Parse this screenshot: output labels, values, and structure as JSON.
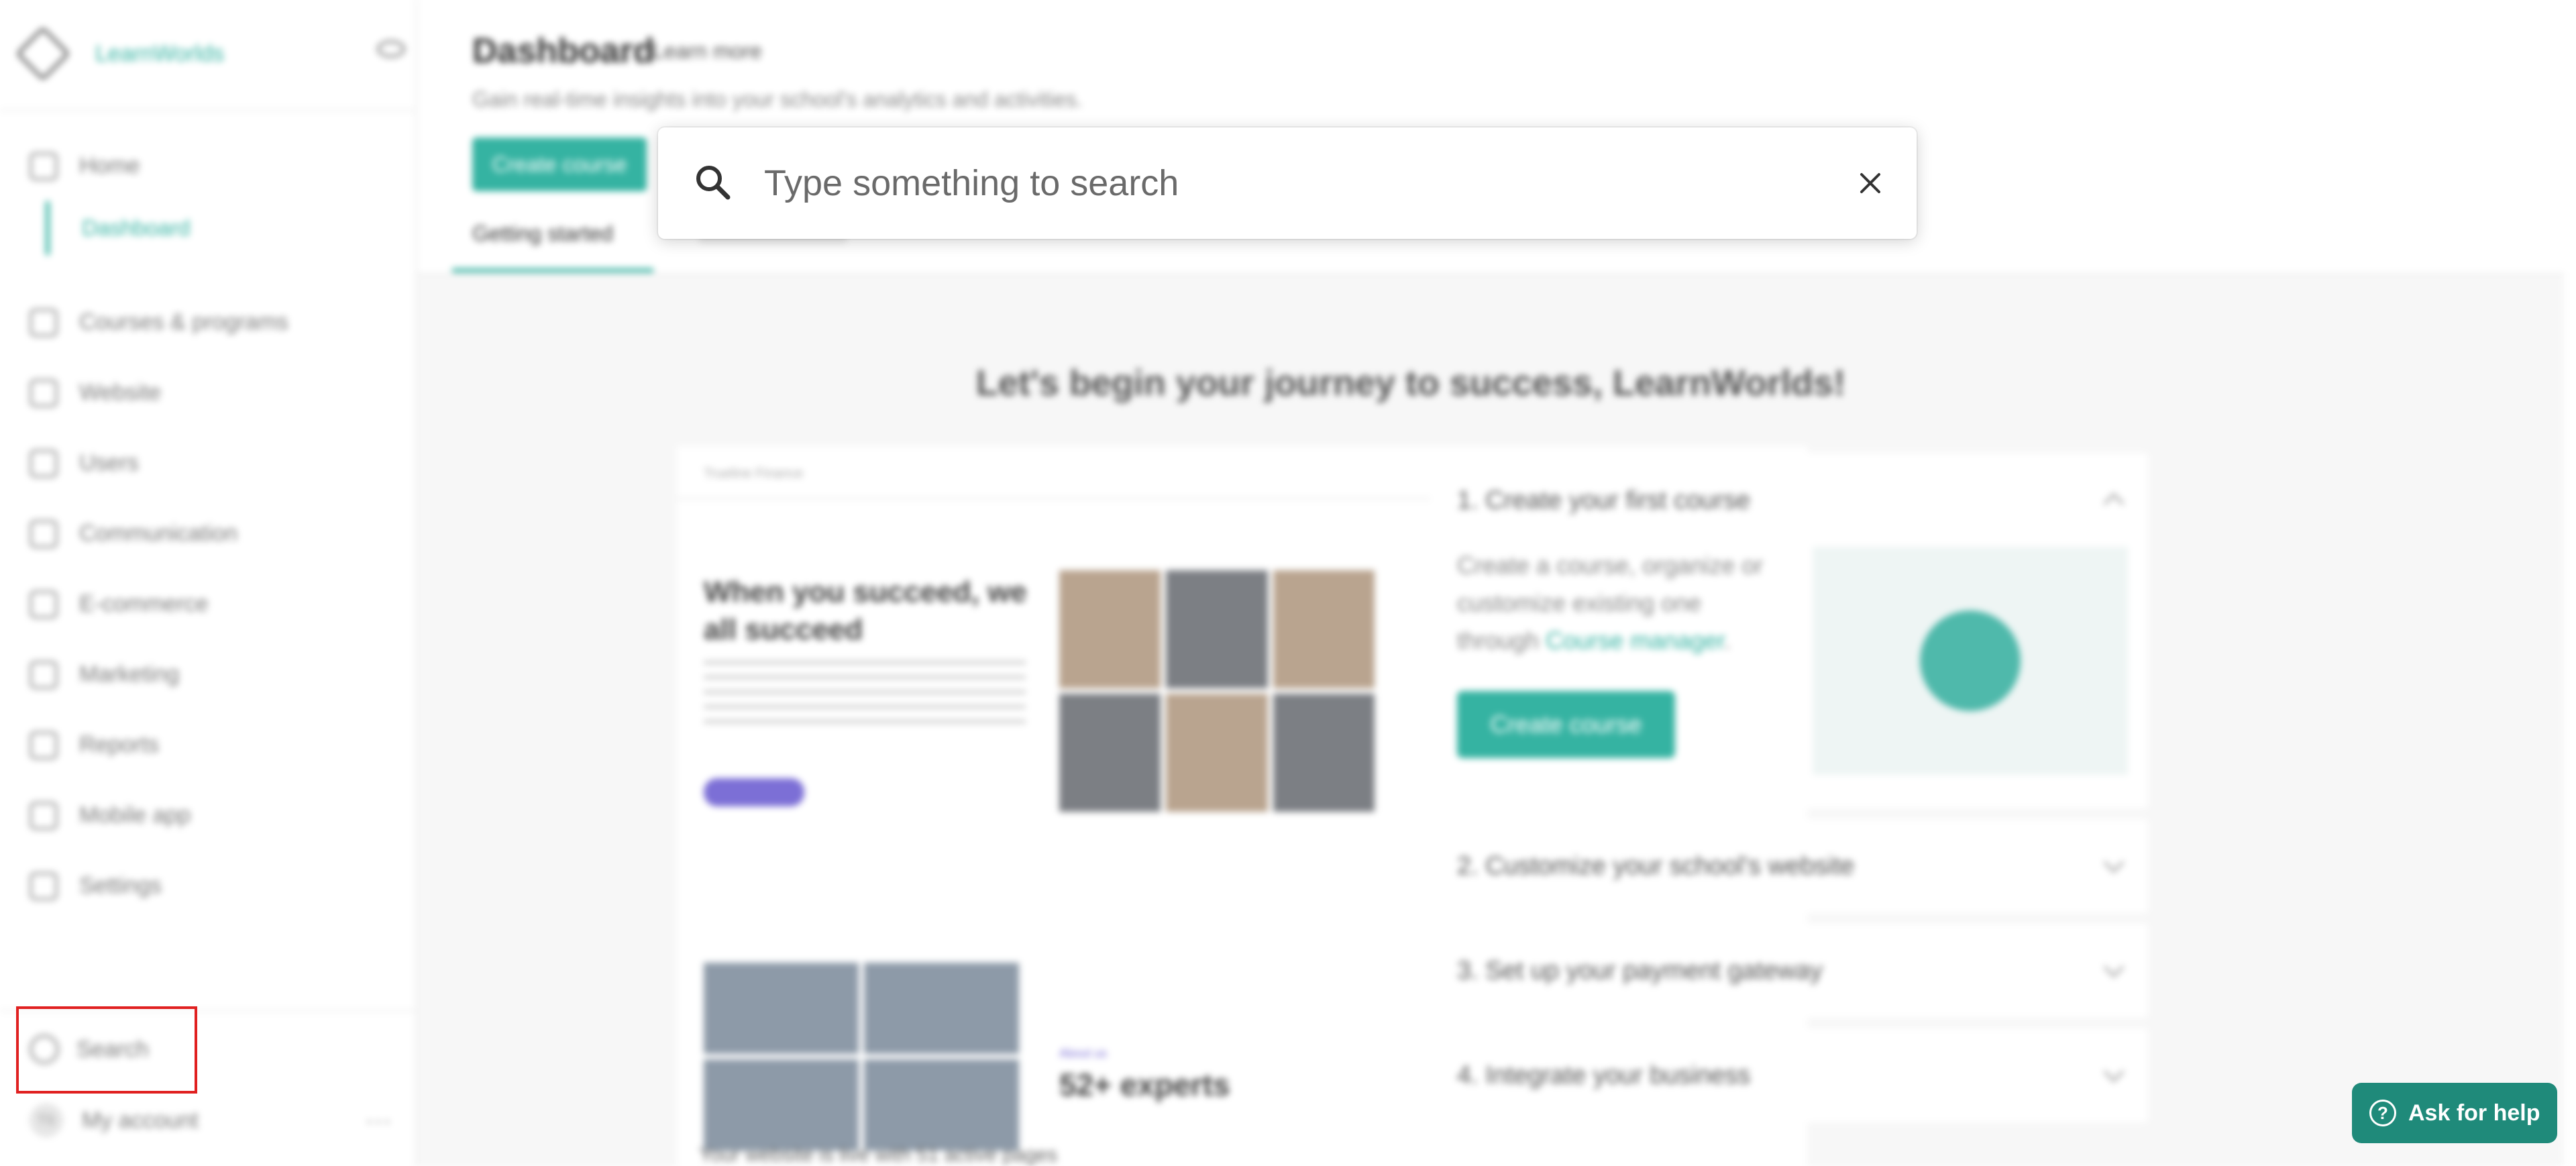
{
  "sidebar": {
    "brand": "LearnWorlds",
    "items": [
      {
        "label": "Home",
        "icon": "home-icon"
      },
      {
        "label": "Courses & programs",
        "icon": "courses-icon"
      },
      {
        "label": "Website",
        "icon": "website-icon"
      },
      {
        "label": "Users",
        "icon": "users-icon"
      },
      {
        "label": "Communication",
        "icon": "mail-icon"
      },
      {
        "label": "E-commerce",
        "icon": "cart-icon"
      },
      {
        "label": "Marketing",
        "icon": "funnel-icon"
      },
      {
        "label": "Reports",
        "icon": "reports-icon"
      },
      {
        "label": "Mobile app",
        "icon": "mobile-icon"
      },
      {
        "label": "Settings",
        "icon": "gear-icon"
      }
    ],
    "subitem": "Dashboard",
    "search_label": "Search",
    "account_initials": "TS",
    "account_label": "My account",
    "more": "···"
  },
  "header": {
    "title": "Dashboard",
    "learn_more": "Learn more",
    "subtitle": "Gain real-time insights into your school's analytics and activities.",
    "create_course": "Create course",
    "tab_active": "Getting started"
  },
  "main": {
    "welcome": "Let's begin your journey to success, LearnWorlds!",
    "preview": {
      "site_name": "Trueline Finance",
      "headline": "When you succeed, we all succeed",
      "experts_label": "About us",
      "experts": "52+ experts",
      "live_text": "Your website is live with 51 active pages"
    },
    "steps": [
      {
        "title": "1. Create your first course",
        "desc_pre": "Create a course, organize or customize existing one through ",
        "desc_link": "Course manager",
        "desc_post": ".",
        "button": "Create course"
      },
      {
        "title": "2. Customize your school's website"
      },
      {
        "title": "3. Set up your payment gateway"
      },
      {
        "title": "4. Integrate your business"
      }
    ]
  },
  "help": {
    "label": "Ask for help"
  },
  "search": {
    "placeholder": "Type something to search",
    "value": ""
  },
  "colors": {
    "accent": "#35b3a2",
    "help": "#1f8a7a",
    "highlight": "#e02020"
  }
}
